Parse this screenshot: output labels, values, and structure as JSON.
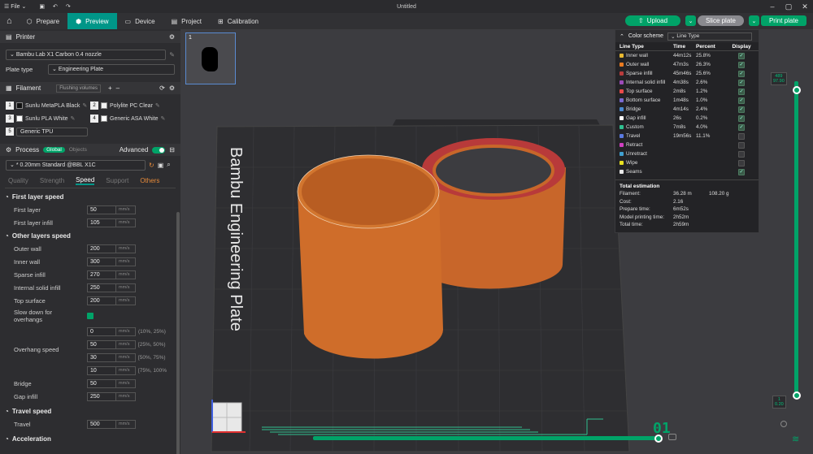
{
  "window": {
    "file_menu": "File",
    "title": "Untitled"
  },
  "toolbar": {
    "tabs": [
      {
        "label": "Prepare"
      },
      {
        "label": "Preview"
      },
      {
        "label": "Device"
      },
      {
        "label": "Project"
      },
      {
        "label": "Calibration"
      }
    ],
    "upload": "Upload",
    "slice": "Slice plate",
    "print": "Print plate"
  },
  "printer": {
    "header": "Printer",
    "model": "Bambu Lab X1 Carbon 0.4 nozzle",
    "plate_type_label": "Plate type",
    "plate_type": "Engineering Plate"
  },
  "filament": {
    "header": "Filament",
    "flushing": "Flushing volumes",
    "items": [
      {
        "num": "1",
        "name": "Sunlu MetaPLA Black",
        "color": "#111111"
      },
      {
        "num": "2",
        "name": "Polylite PC Clear",
        "color": "#f2f2f2"
      },
      {
        "num": "3",
        "name": "Sunlu PLA White",
        "color": "#ffffff"
      },
      {
        "num": "4",
        "name": "Generic ASA White",
        "color": "#ffffff"
      },
      {
        "num": "5",
        "name": "Generic TPU",
        "color": "#2d2d30"
      }
    ]
  },
  "process": {
    "header": "Process",
    "global": "Global",
    "objects": "Objects",
    "advanced": "Advanced",
    "preset": "* 0.20mm Standard @BBL X1C",
    "tabs": [
      "Quality",
      "Strength",
      "Speed",
      "Support",
      "Others"
    ],
    "first_layer_speed": {
      "title": "First layer speed",
      "first_layer": {
        "label": "First layer",
        "value": "50",
        "unit": "mm/s"
      },
      "first_layer_infill": {
        "label": "First layer infill",
        "value": "105",
        "unit": "mm/s"
      }
    },
    "other_layers_speed": {
      "title": "Other layers speed",
      "outer_wall": {
        "label": "Outer wall",
        "value": "200",
        "unit": "mm/s"
      },
      "inner_wall": {
        "label": "Inner wall",
        "value": "300",
        "unit": "mm/s"
      },
      "sparse_infill": {
        "label": "Sparse infill",
        "value": "270",
        "unit": "mm/s"
      },
      "internal_solid_infill": {
        "label": "Internal solid infill",
        "value": "250",
        "unit": "mm/s"
      },
      "top_surface": {
        "label": "Top surface",
        "value": "200",
        "unit": "mm/s"
      },
      "slow_down": {
        "label": "Slow down for overhangs"
      },
      "overhang": {
        "label": "Overhang speed",
        "rows": [
          {
            "value": "0",
            "unit": "mm/s",
            "range": "(10%, 25%)"
          },
          {
            "value": "50",
            "unit": "mm/s",
            "range": "[25%, 50%)"
          },
          {
            "value": "30",
            "unit": "mm/s",
            "range": "[50%, 75%)"
          },
          {
            "value": "10",
            "unit": "mm/s",
            "range": "[75%, 100%"
          }
        ]
      },
      "bridge": {
        "label": "Bridge",
        "value": "50",
        "unit": "mm/s"
      },
      "gap_infill": {
        "label": "Gap infill",
        "value": "250",
        "unit": "mm/s"
      }
    },
    "travel_speed": {
      "title": "Travel speed",
      "travel": {
        "label": "Travel",
        "value": "500",
        "unit": "mm/s"
      }
    },
    "acceleration": {
      "title": "Acceleration"
    }
  },
  "plate": {
    "number": "1",
    "bed_label": "Bambu Engineering Plate"
  },
  "legend": {
    "title": "Color scheme",
    "scheme": "Line Type",
    "columns": [
      "Line Type",
      "Time",
      "Percent",
      "Display"
    ],
    "rows": [
      {
        "name": "Inner wall",
        "time": "44m12s",
        "pct": "25.8%",
        "color": "#e8b830",
        "on": true
      },
      {
        "name": "Outer wall",
        "time": "47m3s",
        "pct": "26.3%",
        "color": "#e87a20",
        "on": true
      },
      {
        "name": "Sparse infill",
        "time": "45m46s",
        "pct": "25.6%",
        "color": "#b83c3c",
        "on": true
      },
      {
        "name": "Internal solid infill",
        "time": "4m38s",
        "pct": "2.6%",
        "color": "#9c4ab8",
        "on": true
      },
      {
        "name": "Top surface",
        "time": "2m8s",
        "pct": "1.2%",
        "color": "#e84a4a",
        "on": true
      },
      {
        "name": "Bottom surface",
        "time": "1m48s",
        "pct": "1.0%",
        "color": "#7a6ad0",
        "on": true
      },
      {
        "name": "Bridge",
        "time": "4m14s",
        "pct": "2.4%",
        "color": "#4a8ad0",
        "on": true
      },
      {
        "name": "Gap infill",
        "time": "26s",
        "pct": "0.2%",
        "color": "#ffffff",
        "on": true
      },
      {
        "name": "Custom",
        "time": "7m8s",
        "pct": "4.0%",
        "color": "#30c090",
        "on": true
      },
      {
        "name": "Travel",
        "time": "19m56s",
        "pct": "11.1%",
        "color": "#5a7ae0",
        "on": false
      },
      {
        "name": "Retract",
        "time": "",
        "pct": "",
        "color": "#d040c0",
        "on": false
      },
      {
        "name": "Unretract",
        "time": "",
        "pct": "",
        "color": "#40a0d0",
        "on": false
      },
      {
        "name": "Wipe",
        "time": "",
        "pct": "",
        "color": "#e8e020",
        "on": false
      },
      {
        "name": "Seams",
        "time": "",
        "pct": "",
        "color": "#e8e8e8",
        "on": true
      }
    ],
    "total_title": "Total estimation",
    "totals": [
      {
        "k": "Filament:",
        "v": "36.28 m",
        "v2": "108.20 g"
      },
      {
        "k": "Cost:",
        "v": "2.16",
        "v2": ""
      },
      {
        "k": "Prepare time:",
        "v": "6m52s",
        "v2": ""
      },
      {
        "k": "Model printing time:",
        "v": "2h52m",
        "v2": ""
      },
      {
        "k": "Total time:",
        "v": "2h59m",
        "v2": ""
      }
    ]
  },
  "layers": {
    "top_num": "489",
    "top_height": "97.90",
    "bottom_num": "1",
    "bottom_height": "0.20",
    "move": "01"
  }
}
